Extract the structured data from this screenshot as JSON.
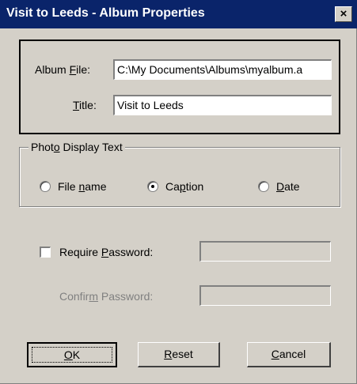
{
  "window": {
    "title": "Visit to Leeds - Album Properties",
    "close_glyph": "×"
  },
  "album": {
    "file_label_pre": "Album ",
    "file_label_ul": "F",
    "file_label_post": "ile:",
    "file_value": "C:\\My Documents\\Albums\\myalbum.a",
    "title_label_ul": "T",
    "title_label_post": "itle:",
    "title_value": "Visit to Leeds"
  },
  "photo_display": {
    "group_label_pre": "Phot",
    "group_label_ul": "o",
    "group_label_post": " Display Text",
    "options": [
      {
        "pre": "File ",
        "ul": "n",
        "post": "ame",
        "selected": false
      },
      {
        "pre": "Ca",
        "ul": "p",
        "post": "tion",
        "selected": true
      },
      {
        "pre": "",
        "ul": "D",
        "post": "ate",
        "selected": false
      }
    ]
  },
  "password": {
    "require_pre": "Require ",
    "require_ul": "P",
    "require_post": "assword:",
    "require_checked": false,
    "password_value": "",
    "confirm_pre": "Confir",
    "confirm_ul": "m",
    "confirm_post": " Password:",
    "confirm_value": ""
  },
  "buttons": {
    "ok_ul": "O",
    "ok_post": "K",
    "reset_ul": "R",
    "reset_post": "eset",
    "cancel_ul": "C",
    "cancel_post": "ancel"
  },
  "colors": {
    "titlebar": "#0a246a",
    "face": "#d4d0c8"
  }
}
